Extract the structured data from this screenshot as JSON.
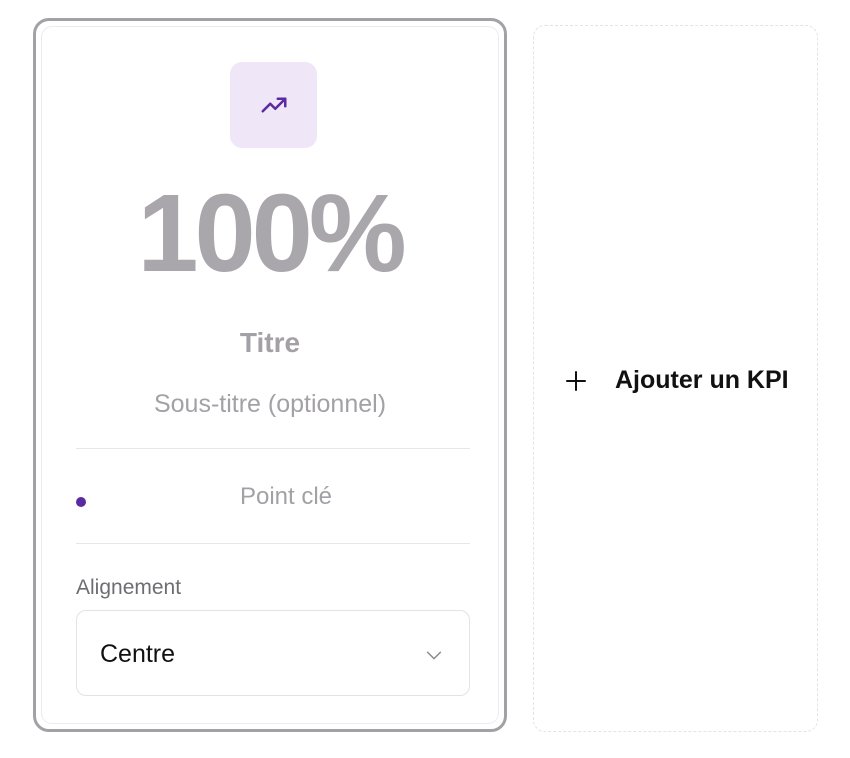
{
  "kpi_card": {
    "icon": "trending-up-icon",
    "value": "100%",
    "title": "Titre",
    "subtitle": "Sous-titre (optionnel)",
    "bullet_point": "Point clé",
    "alignment": {
      "label": "Alignement",
      "selected": "Centre"
    }
  },
  "add_kpi": {
    "label": "Ajouter un KPI",
    "icon": "plus-icon"
  },
  "colors": {
    "accent": "#5b2aa0",
    "icon_tile_bg": "#efe7f8",
    "muted_text": "#a3a1a5"
  }
}
